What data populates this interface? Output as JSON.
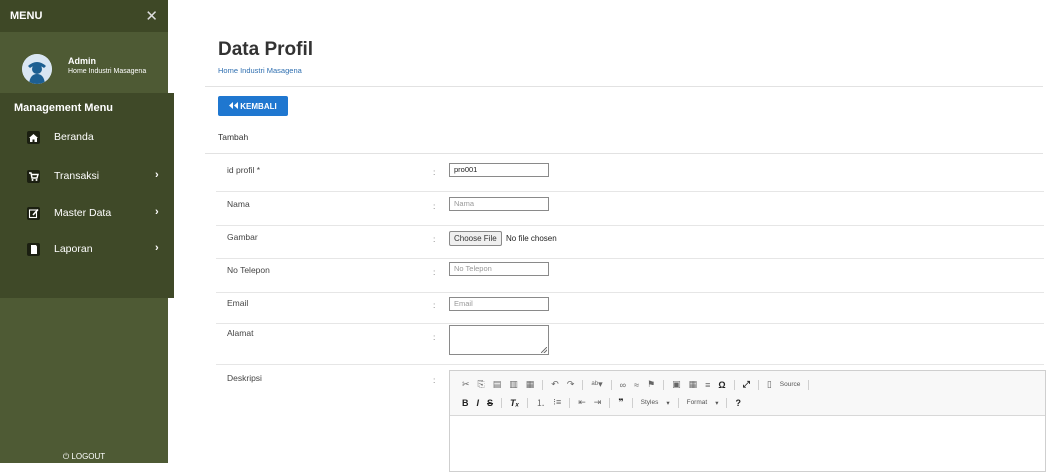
{
  "sidebar": {
    "menu_title": "MENU",
    "close_glyph": "✕",
    "user": {
      "name": "Admin",
      "subtitle": "Home Industri Masagena"
    },
    "management_label": "Management Menu",
    "items": [
      {
        "label": "Beranda",
        "icon": "home-icon",
        "has_submenu": false
      },
      {
        "label": "Transaksi",
        "icon": "cart-icon",
        "has_submenu": true
      },
      {
        "label": "Master Data",
        "icon": "edit-icon",
        "has_submenu": true
      },
      {
        "label": "Laporan",
        "icon": "document-icon",
        "has_submenu": true
      }
    ],
    "chevron": "›",
    "logout_label": "LOGOUT",
    "colors": {
      "sidebar_bg": "#4e5a34",
      "menu_bg": "#3f4928"
    }
  },
  "main": {
    "title": "Data Profil",
    "breadcrumb": "Home Industri Masagena",
    "back_button": {
      "label": "KEMBALI",
      "icon": "double-chevron-left-icon",
      "color": "#1f77d0"
    },
    "section_title": "Tambah",
    "colon": ":",
    "fields": {
      "id_profil": {
        "label": "id profil *",
        "value": "pro001"
      },
      "nama": {
        "label": "Nama",
        "placeholder": "Nama"
      },
      "gambar": {
        "label": "Gambar",
        "button": "Choose File",
        "status": "No file chosen"
      },
      "no_telepon": {
        "label": "No Telepon",
        "placeholder": "No Telepon"
      },
      "email": {
        "label": "Email",
        "placeholder": "Email"
      },
      "alamat": {
        "label": "Alamat"
      },
      "deskripsi": {
        "label": "Deskripsi"
      }
    },
    "editor": {
      "row1": [
        "cut-icon",
        "copy-icon",
        "paste-icon",
        "paste-text-icon",
        "paste-word-icon",
        "undo-icon",
        "redo-icon",
        "spellcheck-icon",
        "link-icon",
        "unlink-icon",
        "anchor-icon",
        "image-icon",
        "table-icon",
        "horizontal-line-icon",
        "special-char-icon",
        "maximize-icon",
        "source-icon"
      ],
      "source_label": "Source",
      "row2": [
        "bold-icon",
        "italic-icon",
        "strike-icon",
        "remove-format-icon",
        "numbered-list-icon",
        "bulleted-list-icon",
        "outdent-icon",
        "indent-icon",
        "blockquote-icon"
      ],
      "styles_label": "Styles",
      "format_label": "Format",
      "help_label": "?"
    }
  }
}
